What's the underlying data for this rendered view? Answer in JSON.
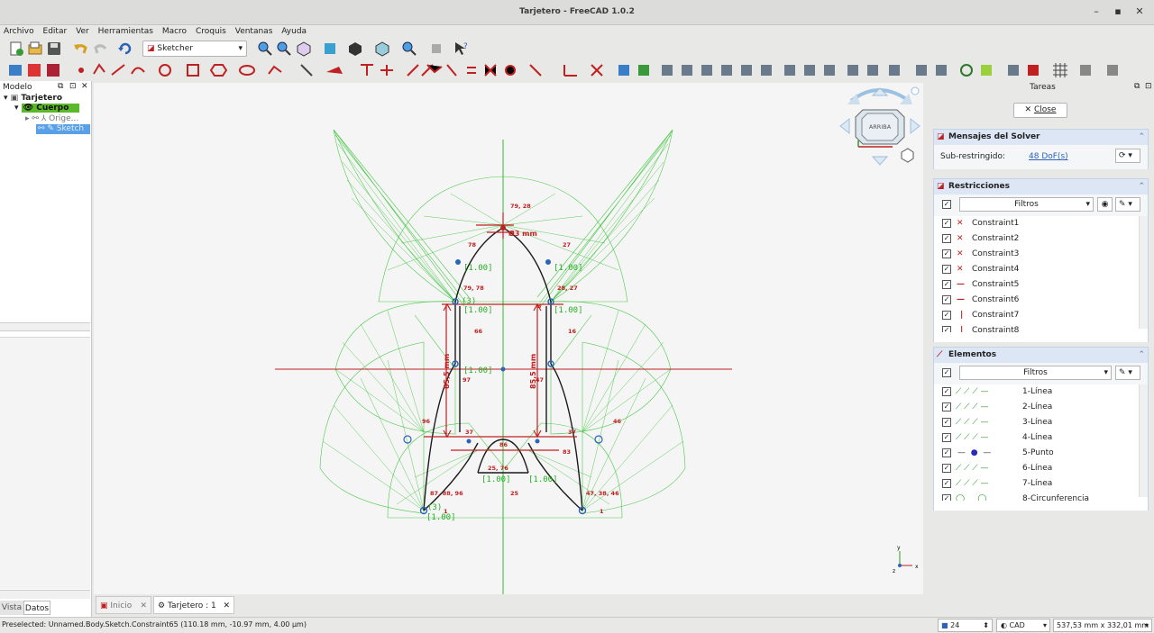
{
  "window": {
    "title": "Tarjetero - FreeCAD 1.0.2"
  },
  "menu": [
    "Archivo",
    "Editar",
    "Ver",
    "Herramientas",
    "Macro",
    "Croquis",
    "Ventanas",
    "Ayuda"
  ],
  "toolbar": {
    "workbench": "Sketcher"
  },
  "model_panel": {
    "title": "Modelo",
    "tree": [
      {
        "label": "Tarjetero"
      },
      {
        "label": "Cuerpo"
      },
      {
        "label": "Orige..."
      },
      {
        "label": "Sketch"
      }
    ],
    "tabs": [
      "Vista",
      "Datos"
    ]
  },
  "navcube": {
    "face": "ARRIBA"
  },
  "sketch_labels": {
    "red": [
      "79, 28",
      "78",
      "27",
      "79, 78",
      "28, 27",
      "66",
      "16",
      "97",
      "47",
      "96",
      "46",
      "37",
      "37",
      "83",
      "25, 76",
      "86",
      "87, 88, 96",
      "47, 38, 46",
      "25",
      "1",
      "1",
      "Ø3 mm",
      "85,5 mm",
      "85,5 mm",
      "3"
    ],
    "green": [
      "[1.00]",
      "[1.00]",
      "[1.00]",
      "[1.00]",
      "[1.00]",
      "[1.00]",
      "[1.00]",
      "[1.00]",
      "(3)",
      "(3)"
    ]
  },
  "tasks": {
    "title": "Tareas",
    "close_label": "Close",
    "solver": {
      "title": "Mensajes del Solver",
      "status_label": "Sub-restringido:",
      "dof_link": "48 DoF(s)"
    },
    "constraints": {
      "title": "Restricciones",
      "filter_label": "Filtros",
      "items": [
        "Constraint1",
        "Constraint2",
        "Constraint3",
        "Constraint4",
        "Constraint5",
        "Constraint6",
        "Constraint7",
        "Constraint8"
      ]
    },
    "elements": {
      "title": "Elementos",
      "filter_label": "Filtros",
      "items": [
        "1-Línea",
        "2-Línea",
        "3-Línea",
        "4-Línea",
        "5-Punto",
        "6-Línea",
        "7-Línea",
        "8-Circunferencia"
      ]
    }
  },
  "doc_tabs": [
    {
      "label": "Inicio"
    },
    {
      "label": "Tarjetero : 1"
    }
  ],
  "status": {
    "message": "Preselected: Unnamed.Body.Sketch.Constraint65 (110.18 mm, -10.97 mm, 4.00 µm)",
    "snap_value": "24",
    "mode": "CAD",
    "dimensions": "537,53 mm x 332,01 mm"
  },
  "colors": {
    "accent": "#2a63b8",
    "constraint_red": "#c02020",
    "green_lines": "#2ec02e",
    "selected_blue": "#5aa0e6"
  }
}
